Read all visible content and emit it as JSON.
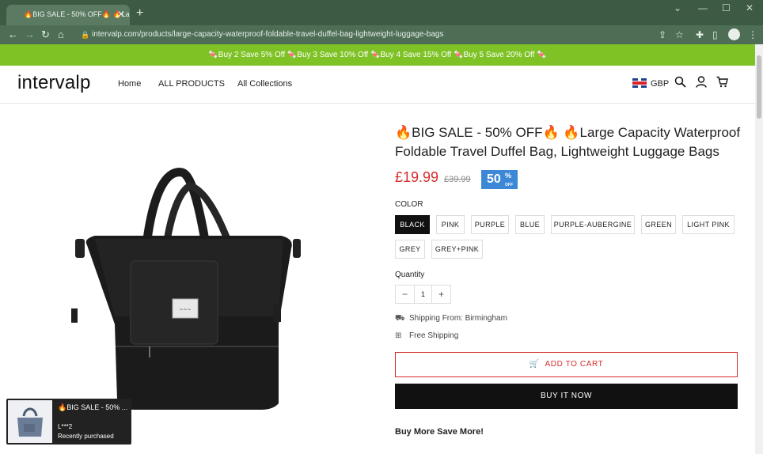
{
  "browser": {
    "tab_title": "🔥BIG SALE - 50% OFF🔥 🔥Lar",
    "url": "intervalp.com/products/large-capacity-waterproof-foldable-travel-duffel-bag-lightweight-luggage-bags"
  },
  "promo": {
    "text": "🍬Buy 2 Save 5% Off 🍬Buy 3 Save 10% Off 🍬Buy 4 Save 15% Off 🍬Buy 5 Save 20% Off 🍬"
  },
  "header": {
    "logo": "intervalp",
    "nav": [
      "Home",
      "ALL PRODUCTS",
      "All Collections"
    ],
    "currency": "GBP"
  },
  "product": {
    "title": "🔥BIG SALE - 50% OFF🔥 🔥Large Capacity Waterproof Foldable Travel Duffel Bag, Lightweight Luggage Bags",
    "price": "£19.99",
    "old_price": "£39.99",
    "discount": "50",
    "discount_pct": "%",
    "discount_off": "OFF",
    "color_label": "COLOR",
    "colors": [
      "BLACK",
      "PINK",
      "PURPLE",
      "BLUE",
      "PURPLE-AUBERGINE",
      "GREEN",
      "LIGHT PINK",
      "GREY",
      "GREY+PINK"
    ],
    "selected_color": "BLACK",
    "quantity_label": "Quantity",
    "quantity": "1",
    "shipping_from": "Shipping From: Birmingham",
    "free_shipping": "Free Shipping",
    "add_to_cart": "ADD TO CART",
    "buy_now": "BUY IT NOW",
    "buy_more": "Buy More Save More!"
  },
  "popup": {
    "title": "🔥BIG SALE - 50% ...",
    "name": "L***2",
    "subtitle": "Recently purchased"
  },
  "colors": {
    "promo_bg": "#7ec225",
    "price": "#d72c2c",
    "discount_bg": "#3d88d6",
    "chrome": "#3d5a45"
  }
}
